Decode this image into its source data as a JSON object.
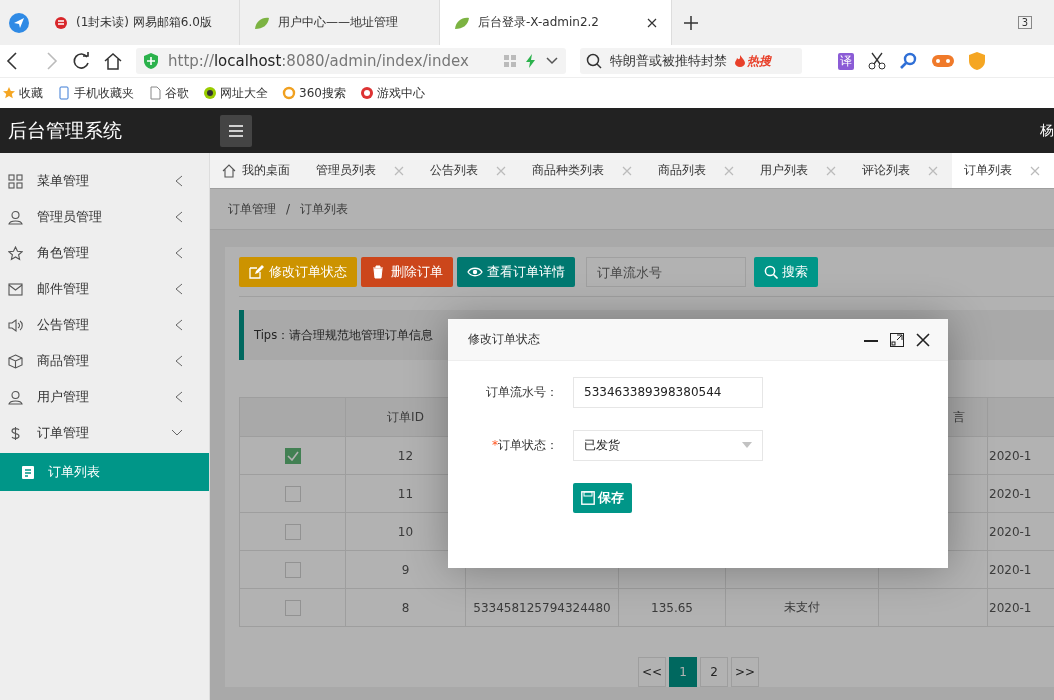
{
  "browser": {
    "tabs": [
      {
        "title": "(1封未读) 网易邮箱6.0版",
        "selected": false
      },
      {
        "title": "用户中心——地址管理",
        "selected": false
      },
      {
        "title": "后台登录-X-admin2.2",
        "selected": true
      }
    ],
    "tab_count": "3",
    "url": "http://**localhost**:8080/admin/index/index",
    "search_text": "特朗普或被推特封禁",
    "hot_label": "热搜",
    "translate_label": "译",
    "bookmarks": [
      "收藏",
      "手机收藏夹",
      "谷歌",
      "网址大全",
      "360搜索",
      "游戏中心"
    ]
  },
  "app": {
    "title": "后台管理系统",
    "user": "杨"
  },
  "sidebar": {
    "items": [
      {
        "label": "菜单管理",
        "expanded": false
      },
      {
        "label": "管理员管理",
        "expanded": false
      },
      {
        "label": "角色管理",
        "expanded": false
      },
      {
        "label": "邮件管理",
        "expanded": false
      },
      {
        "label": "公告管理",
        "expanded": false
      },
      {
        "label": "商品管理",
        "expanded": false
      },
      {
        "label": "用户管理",
        "expanded": false
      },
      {
        "label": "订单管理",
        "expanded": true,
        "children": [
          {
            "label": "订单列表",
            "selected": true
          }
        ]
      }
    ]
  },
  "tabs": [
    {
      "label": "我的桌面",
      "kind": "home",
      "selected": false
    },
    {
      "label": "管理员列表",
      "kind": "closable",
      "selected": false
    },
    {
      "label": "公告列表",
      "kind": "closable",
      "selected": false
    },
    {
      "label": "商品种类列表",
      "kind": "closable",
      "selected": false
    },
    {
      "label": "商品列表",
      "kind": "closable",
      "selected": false
    },
    {
      "label": "用户列表",
      "kind": "closable",
      "selected": false
    },
    {
      "label": "评论列表",
      "kind": "closable",
      "selected": false
    },
    {
      "label": "订单列表",
      "kind": "closable",
      "selected": true
    }
  ],
  "breadcrumb": [
    "订单管理",
    "订单列表"
  ],
  "breadcrumb_separator": "/",
  "toolbar": {
    "buttons": [
      {
        "label": "修改订单状态",
        "kind": "edit",
        "color": "#cc9300"
      },
      {
        "label": "删除订单",
        "kind": "delete",
        "color": "#cc461b"
      },
      {
        "label": "查看订单详情",
        "kind": "view",
        "color": "#007870"
      }
    ],
    "search_placeholder": "订单流水号",
    "search_button": "搜索"
  },
  "tips": "Tips：请合理规范地管理订单信息",
  "table": {
    "headers": {
      "column_2": "订单ID",
      "column_6": "言"
    },
    "rows": [
      {
        "checked": true,
        "cells": {
          "column_2": "12",
          "column_7": "2020-1"
        }
      },
      {
        "checked": false,
        "cells": {
          "column_2": "11",
          "column_7": "2020-1"
        }
      },
      {
        "checked": false,
        "cells": {
          "column_2": "10",
          "column_7": "2020-1"
        }
      },
      {
        "checked": false,
        "cells": {
          "column_2": "9",
          "column_7": "2020-1"
        }
      },
      {
        "checked": false,
        "cells": {
          "column_2": "8",
          "column_3": "533458125794324480",
          "column_4": "135.65",
          "column_5": "未支付",
          "column_7": "2020-1"
        }
      }
    ]
  },
  "pagination": {
    "prev": "<<",
    "next": ">>",
    "pages": [
      {
        "label": "1",
        "selected": true
      },
      {
        "label": "2",
        "selected": false
      }
    ]
  },
  "modal": {
    "title": "修改订单状态",
    "required_mark": "*",
    "fields": [
      {
        "label": "订单流水号：",
        "kind": "text",
        "value": "533463389398380544",
        "required": false
      },
      {
        "label": "订单状态：",
        "kind": "select",
        "value": "已发货",
        "required": true
      }
    ],
    "save": "保存"
  }
}
